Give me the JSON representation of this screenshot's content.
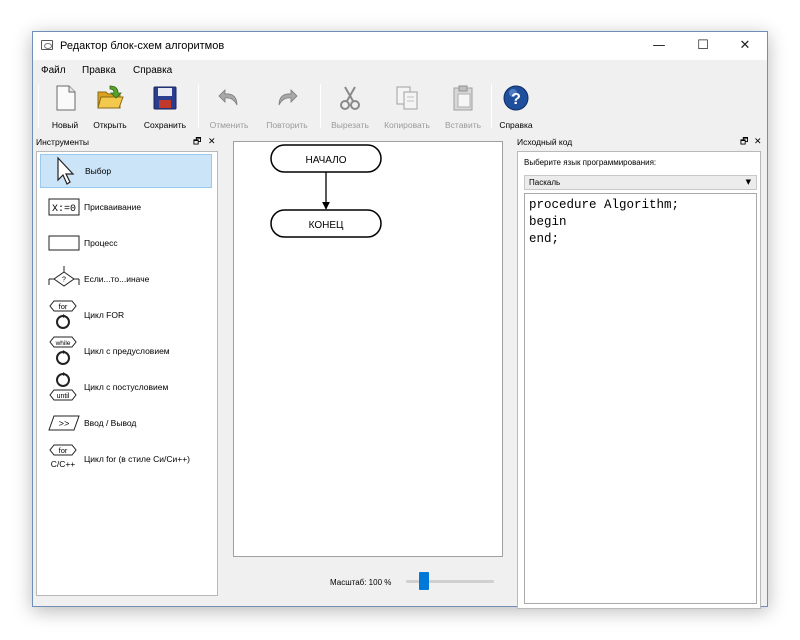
{
  "window": {
    "title": "Редактор блок-схем алгоритмов",
    "controls": {
      "minimize": "—",
      "maximize": "☐",
      "close": "✕"
    }
  },
  "menu": [
    "Файл",
    "Правка",
    "Справка"
  ],
  "toolbar": [
    {
      "label": "Новый",
      "icon": "new-file-icon",
      "enabled": true
    },
    {
      "label": "Открыть",
      "icon": "open-folder-icon",
      "enabled": true
    },
    {
      "label": "Сохранить",
      "icon": "save-disk-icon",
      "enabled": true
    },
    {
      "label": "Отменить",
      "icon": "undo-icon",
      "enabled": false
    },
    {
      "label": "Повторить",
      "icon": "redo-icon",
      "enabled": false
    },
    {
      "label": "Вырезать",
      "icon": "cut-icon",
      "enabled": false
    },
    {
      "label": "Копировать",
      "icon": "copy-icon",
      "enabled": false
    },
    {
      "label": "Вставить",
      "icon": "paste-icon",
      "enabled": false
    },
    {
      "label": "Справка",
      "icon": "help-icon",
      "enabled": true
    }
  ],
  "tools_panel": {
    "title": "Инструменты",
    "float": "🗗",
    "close": "✕",
    "items": [
      {
        "label": "Выбор",
        "icon": "pointer-icon",
        "selected": true
      },
      {
        "label": "Присваивание",
        "icon": "assignment-icon",
        "glyph": "X:=0"
      },
      {
        "label": "Процесс",
        "icon": "process-icon"
      },
      {
        "label": "Если...то...иначе",
        "icon": "if-then-else-icon"
      },
      {
        "label": "Цикл FOR",
        "icon": "for-loop-icon",
        "glyph": "for"
      },
      {
        "label": "Цикл с предусловием",
        "icon": "while-loop-icon",
        "glyph": "while"
      },
      {
        "label": "Цикл с постусловием",
        "icon": "until-loop-icon",
        "glyph": "until"
      },
      {
        "label": "Ввод / Вывод",
        "icon": "input-output-icon",
        "glyph": ">>"
      },
      {
        "label": "Цикл for (в стиле Си/Си++)",
        "icon": "c-for-loop-icon",
        "glyph": "for",
        "glyph2": "C/C++"
      }
    ]
  },
  "canvas": {
    "blocks": [
      "НАЧАЛО",
      "КОНЕЦ"
    ],
    "zoom_label": "Масштаб: 100 %",
    "zoom_percent": 100
  },
  "source_panel": {
    "title": "Исходный код",
    "float": "🗗",
    "close": "✕",
    "language_label": "Выберите язык программирования:",
    "language": "Паскаль",
    "dropdown_arrow": "▼",
    "code": "procedure Algorithm;\nbegin\nend;"
  },
  "colors": {
    "selection": "#cce4f7",
    "slider": "#0078d7",
    "help": "#1f4e9c",
    "folder": "#e8b830",
    "save": "#2a3d8f"
  }
}
